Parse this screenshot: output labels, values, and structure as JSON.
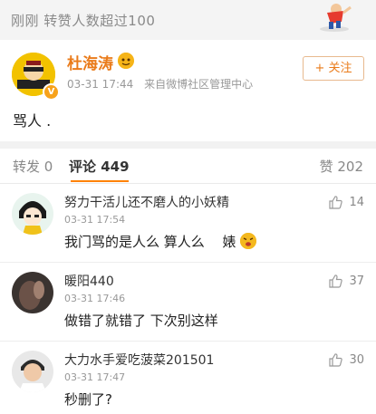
{
  "top_notice": {
    "time": "刚刚",
    "text": "转赞人数超过100"
  },
  "post": {
    "username": "杜海涛",
    "time": "03-31 17:44",
    "source": "来自微博社区管理中心",
    "follow_label": "+ 关注",
    "content": "骂人 ."
  },
  "tabs": {
    "repost_label": "转发 0",
    "comment_label": "评论",
    "comment_count": "449",
    "like_label": "赞 202"
  },
  "comments": [
    {
      "name": "努力干活儿还不磨人的小妖精",
      "time": "03-31 17:54",
      "text": "我门骂的是人么 算人么 　婊",
      "likes": "14"
    },
    {
      "name": "暖阳440",
      "time": "03-31 17:46",
      "text": "做错了就错了 下次别这样",
      "likes": "37"
    },
    {
      "name": "大力水手爱吃菠菜201501",
      "time": "03-31 17:47",
      "text": "秒删了?",
      "likes": "30"
    }
  ]
}
